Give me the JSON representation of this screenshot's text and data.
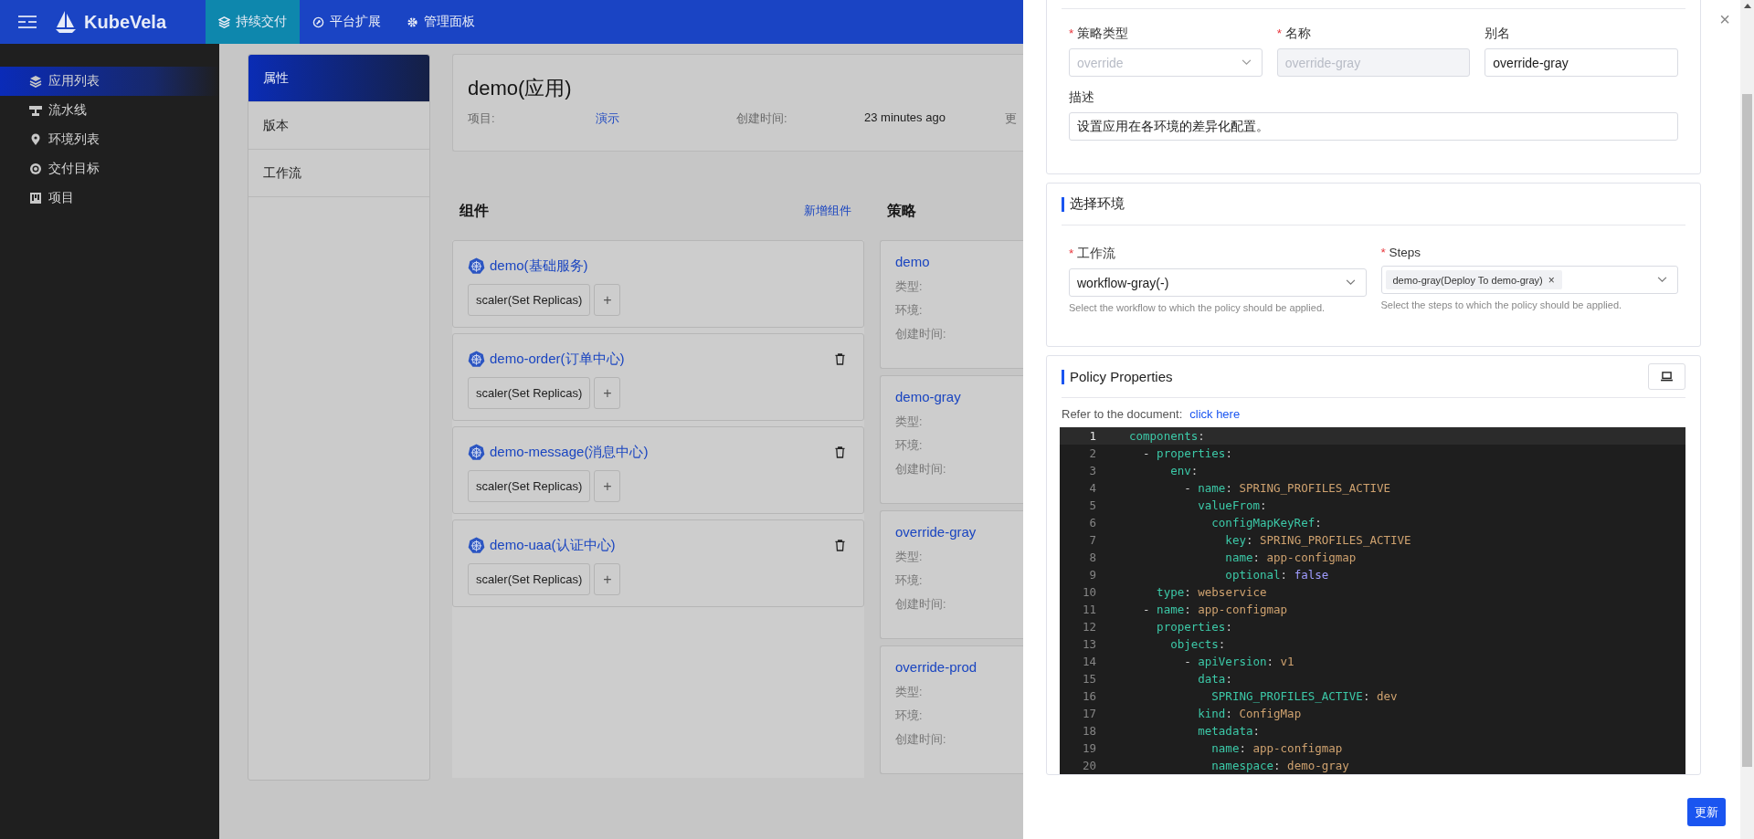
{
  "header": {
    "logo": "KubeVela",
    "nav": [
      {
        "label": "持续交付",
        "selected": true
      },
      {
        "label": "平台扩展",
        "selected": false
      },
      {
        "label": "管理面板",
        "selected": false
      }
    ]
  },
  "sidebar": {
    "items": [
      {
        "label": "应用列表",
        "selected": true
      },
      {
        "label": "流水线",
        "selected": false
      },
      {
        "label": "环境列表",
        "selected": false
      },
      {
        "label": "交付目标",
        "selected": false
      },
      {
        "label": "项目",
        "selected": false
      }
    ]
  },
  "tabs": [
    {
      "label": "属性",
      "selected": true
    },
    {
      "label": "版本",
      "selected": false
    },
    {
      "label": "工作流",
      "selected": false
    }
  ],
  "app": {
    "title": "demo(应用)",
    "meta": [
      {
        "label": "项目:",
        "value": "演示",
        "kind": "link"
      },
      {
        "label": "创建时间:",
        "value": "23 minutes ago",
        "kind": "text"
      }
    ],
    "cut_label": "更"
  },
  "components": {
    "title": "组件",
    "add_link": "新增组件",
    "items": [
      {
        "name": "demo(基础服务)",
        "deletable": false,
        "traits": [
          "scaler(Set Replicas)"
        ],
        "add": "+"
      },
      {
        "name": "demo-order(订单中心)",
        "deletable": true,
        "traits": [
          "scaler(Set Replicas)"
        ],
        "add": "+"
      },
      {
        "name": "demo-message(消息中心)",
        "deletable": true,
        "traits": [
          "scaler(Set Replicas)"
        ],
        "add": "+"
      },
      {
        "name": "demo-uaa(认证中心)",
        "deletable": true,
        "traits": [
          "scaler(Set Replicas)"
        ],
        "add": "+"
      }
    ]
  },
  "policies": {
    "title": "策略",
    "items": [
      {
        "name": "demo",
        "fields": [
          "类型:",
          "环境:",
          "创建时间:"
        ]
      },
      {
        "name": "demo-gray",
        "fields": [
          "类型:",
          "环境:",
          "创建时间:"
        ]
      },
      {
        "name": "override-gray",
        "fields": [
          "类型:",
          "环境:",
          "创建时间:"
        ]
      },
      {
        "name": "override-prod",
        "fields": [
          "类型:",
          "环境:",
          "创建时间:"
        ]
      }
    ]
  },
  "drawer": {
    "close": "×",
    "required_mark": "*",
    "basic": {
      "fields": [
        {
          "label": "策略类型",
          "required": true,
          "kind": "select",
          "value": "override",
          "disabled": true
        },
        {
          "label": "名称",
          "required": true,
          "kind": "input",
          "value": "override-gray",
          "disabled": true
        },
        {
          "label": "别名",
          "required": false,
          "kind": "input",
          "value": "override-gray",
          "disabled": false
        }
      ],
      "description": {
        "label": "描述",
        "value": "设置应用在各环境的差异化配置。"
      }
    },
    "environment": {
      "title": "选择环境",
      "fields": [
        {
          "label": "工作流",
          "required": true,
          "kind": "select",
          "value": "workflow-gray(-)",
          "help": "Select the workflow to which the policy should be applied."
        },
        {
          "label": "Steps",
          "required": true,
          "kind": "tags",
          "tags": [
            "demo-gray(Deploy To demo-gray)"
          ],
          "tag_close": "×",
          "help": "Select the steps to which the policy should be applied."
        }
      ]
    },
    "properties": {
      "title": "Policy Properties",
      "refer_label": "Refer to the document:",
      "refer_link": "click here",
      "code": [
        {
          "number": "1",
          "text": "components:",
          "kind": "plain",
          "active": true
        },
        {
          "number": "2",
          "text": "  - properties:",
          "kind": "plain",
          "active": false
        },
        {
          "number": "3",
          "text": "      env:",
          "kind": "plain",
          "active": false
        },
        {
          "number": "4",
          "text": "        - name: SPRING_PROFILES_ACTIVE",
          "kind": "string",
          "active": false
        },
        {
          "number": "5",
          "text": "          valueFrom:",
          "kind": "plain",
          "active": false
        },
        {
          "number": "6",
          "text": "            configMapKeyRef:",
          "kind": "plain",
          "active": false
        },
        {
          "number": "7",
          "text": "              key: SPRING_PROFILES_ACTIVE",
          "kind": "string",
          "active": false
        },
        {
          "number": "8",
          "text": "              name: app-configmap",
          "kind": "string",
          "active": false
        },
        {
          "number": "9",
          "text": "              optional: false",
          "kind": "bool",
          "active": false
        },
        {
          "number": "10",
          "text": "    type: webservice",
          "kind": "string",
          "active": false
        },
        {
          "number": "11",
          "text": "  - name: app-configmap",
          "kind": "string",
          "active": false
        },
        {
          "number": "12",
          "text": "    properties:",
          "kind": "plain",
          "active": false
        },
        {
          "number": "13",
          "text": "      objects:",
          "kind": "plain",
          "active": false
        },
        {
          "number": "14",
          "text": "        - apiVersion: v1",
          "kind": "string",
          "active": false
        },
        {
          "number": "15",
          "text": "          data:",
          "kind": "plain",
          "active": false
        },
        {
          "number": "16",
          "text": "            SPRING_PROFILES_ACTIVE: dev",
          "kind": "string",
          "active": false
        },
        {
          "number": "17",
          "text": "          kind: ConfigMap",
          "kind": "string",
          "active": false
        },
        {
          "number": "18",
          "text": "          metadata:",
          "kind": "plain",
          "active": false
        },
        {
          "number": "19",
          "text": "            name: app-configmap",
          "kind": "string",
          "active": false
        },
        {
          "number": "20",
          "text": "            namespace: demo-gray",
          "kind": "string",
          "active": false
        }
      ]
    },
    "submit": "更新"
  }
}
